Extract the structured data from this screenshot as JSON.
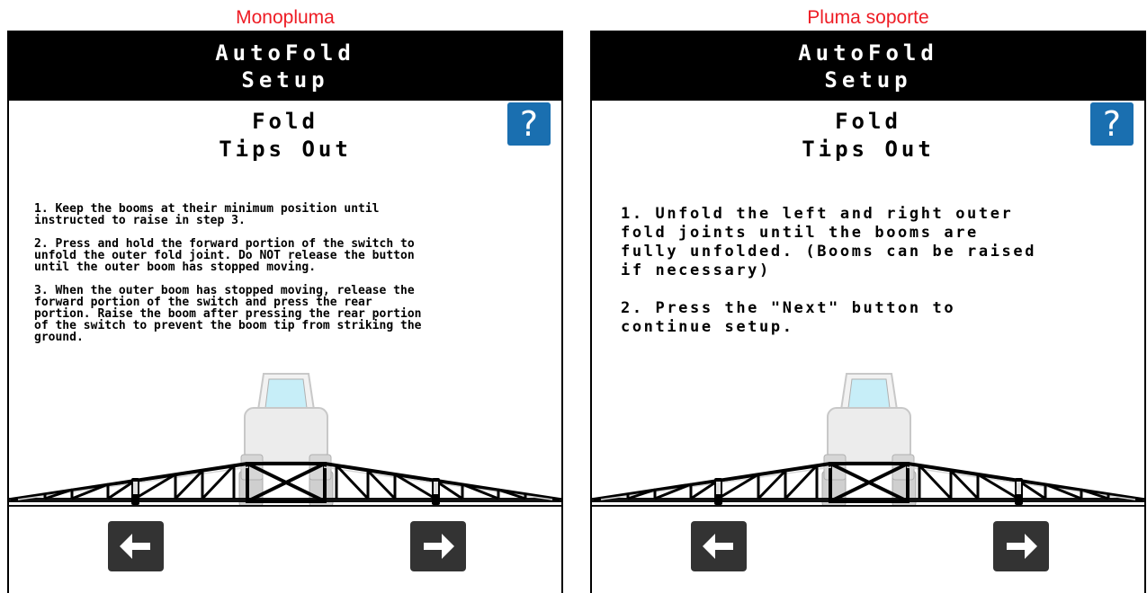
{
  "captions": {
    "left": "Monopluma",
    "right": "Pluma soporte"
  },
  "screens": [
    {
      "header": {
        "line1": "AutoFold",
        "line2": "Setup"
      },
      "title": {
        "line1": "Fold",
        "line2": "Tips Out"
      },
      "help_label": "?",
      "instructions": [
        "1. Keep the booms at their minimum position until\ninstructed to raise in step 3.",
        "2. Press and hold the forward portion of the switch to\nunfold the outer fold joint. Do NOT release the button\nuntil the outer boom has stopped moving.",
        "3. When the outer boom has stopped moving, release the\nforward portion of the switch and press the rear\nportion. Raise the boom after pressing the rear portion\nof the switch to prevent the boom tip from striking the\nground."
      ]
    },
    {
      "header": {
        "line1": "AutoFold",
        "line2": "Setup"
      },
      "title": {
        "line1": "Fold",
        "line2": "Tips Out"
      },
      "help_label": "?",
      "instructions": [
        "1. Unfold the left and right outer\nfold joints until the booms are\nfully unfolded. (Booms can be raised\nif necessary)",
        "2. Press the \"Next\" button to\ncontinue setup."
      ]
    }
  ],
  "icons": {
    "help": "question-mark-icon",
    "back": "arrow-left-icon",
    "next": "arrow-right-icon",
    "illustration": "sprayer-boom-illustration"
  },
  "colors": {
    "caption": "#ee1c24",
    "header_bg": "#000000",
    "help_bg": "#1a6fb0",
    "nav_bg": "#333333"
  }
}
